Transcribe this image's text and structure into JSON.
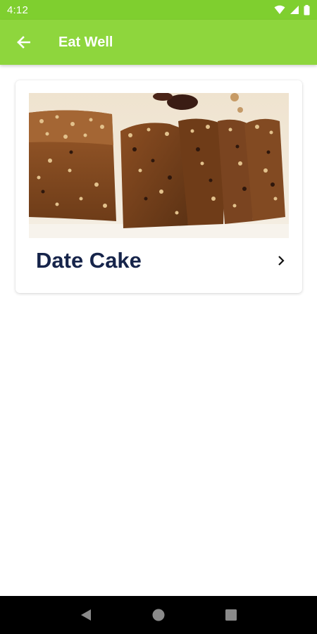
{
  "status_bar": {
    "time": "4:12",
    "icons": [
      "wifi-icon",
      "signal-icon",
      "battery-icon"
    ]
  },
  "app_bar": {
    "title": "Eat Well",
    "back_icon": "arrow-left-icon"
  },
  "recipe_card": {
    "title": "Date Cake",
    "image_description": "",
    "chevron_icon": "chevron-right-icon"
  },
  "nav_bar": {
    "icons": [
      "back-triangle-icon",
      "home-circle-icon",
      "recents-square-icon"
    ]
  },
  "colors": {
    "app_bar": "#8ed63d",
    "status_bar": "#7fcf2f",
    "title_text": "#16244a"
  }
}
